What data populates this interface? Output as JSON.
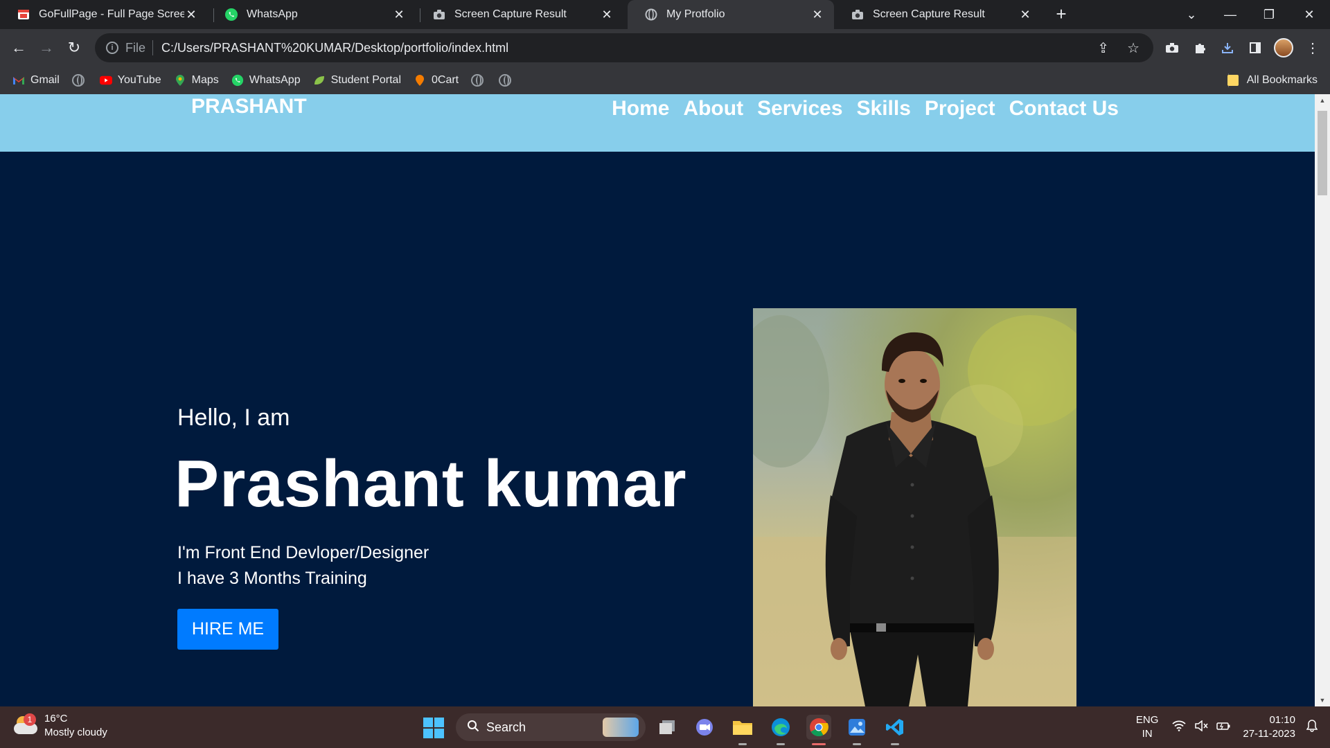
{
  "browser": {
    "tabs": [
      {
        "title": "GoFullPage - Full Page Screen Ca",
        "icon": "gofullpage-icon",
        "active": false
      },
      {
        "title": "WhatsApp",
        "icon": "whatsapp-icon",
        "active": false
      },
      {
        "title": "Screen Capture Result",
        "icon": "camera-icon",
        "active": false
      },
      {
        "title": "My Protfolio",
        "icon": "globe-icon",
        "active": true
      },
      {
        "title": "Screen Capture Result",
        "icon": "camera-icon",
        "active": false
      }
    ],
    "address": {
      "scheme": "File",
      "url": "C:/Users/PRASHANT%20KUMAR/Desktop/portfolio/index.html"
    },
    "bookmarks": [
      {
        "label": "Gmail",
        "icon": "gmail-icon"
      },
      {
        "label": "YouTube",
        "icon": "youtube-icon"
      },
      {
        "label": "Maps",
        "icon": "maps-icon"
      },
      {
        "label": "WhatsApp",
        "icon": "whatsapp-icon"
      },
      {
        "label": "Student Portal",
        "icon": "leaf-icon"
      },
      {
        "label": "0Cart",
        "icon": "cart-icon"
      }
    ],
    "all_bookmarks": "All Bookmarks"
  },
  "site": {
    "logo": "PRASHANT",
    "nav": [
      "Home",
      "About",
      "Services",
      "Skills",
      "Project",
      "Contact Us"
    ],
    "hero": {
      "greeting": "Hello, I am",
      "name": "Prashant kumar",
      "role_line1": "I'm Front End Devloper/Designer",
      "role_line2": "I have 3 Months Training",
      "cta": "HIRE ME"
    },
    "colors": {
      "header_bg": "#87ceeb",
      "hero_bg": "#001a3d",
      "cta_bg": "#007bff"
    }
  },
  "taskbar": {
    "weather": {
      "temp": "16°C",
      "condition": "Mostly cloudy",
      "badge": "1"
    },
    "search_placeholder": "Search",
    "lang": {
      "line1": "ENG",
      "line2": "IN"
    },
    "clock": {
      "time": "01:10",
      "date": "27-11-2023"
    }
  }
}
